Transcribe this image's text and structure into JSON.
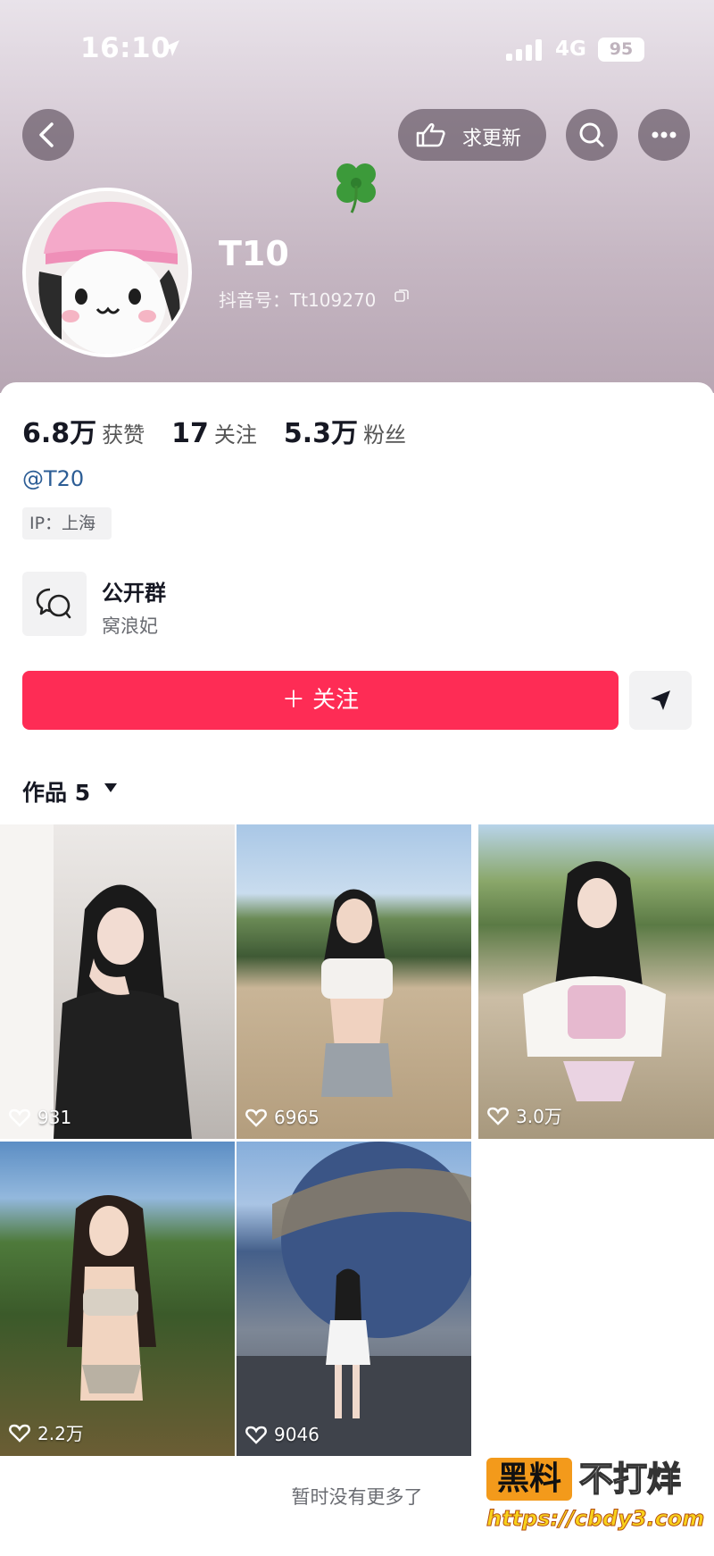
{
  "status_bar": {
    "time": "16:10",
    "network": "4G",
    "battery": "95"
  },
  "header": {
    "request_update_label": "求更新"
  },
  "profile": {
    "username": "T10",
    "douyin_id": "抖音号：Tt109270"
  },
  "stats": [
    {
      "value": "6.8万",
      "label": "获赞"
    },
    {
      "value": "17",
      "label": "关注"
    },
    {
      "value": "5.3万",
      "label": "粉丝"
    }
  ],
  "bio": {
    "mention": "@T20",
    "ip": "IP：上海"
  },
  "group": {
    "title": "公开群",
    "subtitle": "窝浪妃"
  },
  "actions": {
    "follow_label": "＋ 关注"
  },
  "works": {
    "tab_label": "作品 5"
  },
  "videos": [
    {
      "likes": "931"
    },
    {
      "likes": "6965"
    },
    {
      "likes": "3.0万"
    },
    {
      "likes": "2.2万"
    },
    {
      "likes": "9046"
    }
  ],
  "footer": {
    "no_more": "暂时没有更多了"
  },
  "watermark": {
    "badge": "黑料",
    "text": "不打烊",
    "url": "https://cbdy3.com"
  },
  "colors": {
    "follow_button": "#fe2c55",
    "mention": "#2c5d95"
  }
}
